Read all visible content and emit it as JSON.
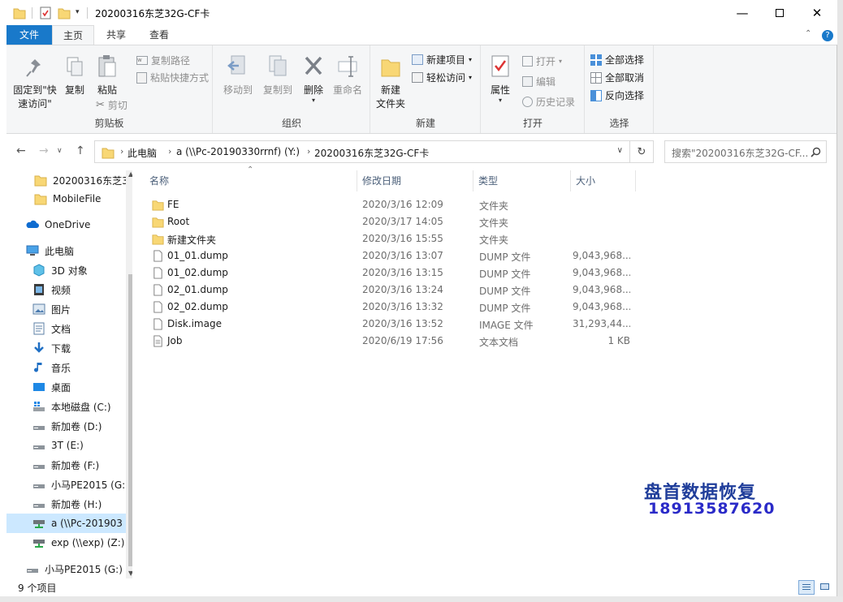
{
  "window": {
    "title": "20200316东芝32G-CF卡",
    "minimize_icon": "minimize-icon",
    "maximize_icon": "maximize-icon",
    "close_icon": "close-icon"
  },
  "ribbon_tabs": [
    "文件",
    "主页",
    "共享",
    "查看"
  ],
  "ribbon": {
    "clipboard": {
      "label": "剪贴板",
      "pin_label_1": "固定到\"快",
      "pin_label_2": "速访问\"",
      "copy": "复制",
      "paste": "粘贴",
      "copy_path": "复制路径",
      "paste_shortcut": "粘贴快捷方式",
      "cut": "剪切"
    },
    "organize": {
      "label": "组织",
      "move_to": "移动到",
      "copy_to": "复制到",
      "delete": "删除",
      "rename": "重命名"
    },
    "new": {
      "label": "新建",
      "new_folder_1": "新建",
      "new_folder_2": "文件夹",
      "new_item": "新建项目",
      "easy_access": "轻松访问"
    },
    "open": {
      "label": "打开",
      "properties": "属性",
      "open": "打开",
      "edit": "编辑",
      "history": "历史记录"
    },
    "select": {
      "label": "选择",
      "select_all": "全部选择",
      "select_none": "全部取消",
      "invert": "反向选择"
    }
  },
  "address": {
    "crumbs": [
      "此电脑",
      "a (\\\\Pc-20190330rrnf) (Y:)",
      "20200316东芝32G-CF卡"
    ],
    "search_placeholder": "搜索\"20200316东芝32G-CF..."
  },
  "nav_pane": {
    "items": [
      {
        "label": "20200316东芝3",
        "icon": "folder-icon"
      },
      {
        "label": "MobileFile",
        "icon": "folder-icon"
      },
      {
        "label": "OneDrive",
        "icon": "cloud-icon"
      },
      {
        "label": "此电脑",
        "icon": "computer-icon"
      },
      {
        "label": "3D 对象",
        "icon": "3d-objects-icon"
      },
      {
        "label": "视频",
        "icon": "video-icon"
      },
      {
        "label": "图片",
        "icon": "pictures-icon"
      },
      {
        "label": "文档",
        "icon": "documents-icon"
      },
      {
        "label": "下载",
        "icon": "download-icon"
      },
      {
        "label": "音乐",
        "icon": "music-icon"
      },
      {
        "label": "桌面",
        "icon": "desktop-icon"
      },
      {
        "label": "本地磁盘 (C:)",
        "icon": "system-drive-icon"
      },
      {
        "label": "新加卷 (D:)",
        "icon": "drive-icon"
      },
      {
        "label": "3T (E:)",
        "icon": "drive-icon"
      },
      {
        "label": "新加卷 (F:)",
        "icon": "drive-icon"
      },
      {
        "label": "小马PE2015 (G:",
        "icon": "drive-icon"
      },
      {
        "label": "新加卷 (H:)",
        "icon": "drive-icon"
      },
      {
        "label": "a (\\\\Pc-201903",
        "icon": "network-drive-icon"
      },
      {
        "label": "exp (\\\\exp) (Z:)",
        "icon": "network-drive-icon"
      },
      {
        "label": "小马PE2015 (G:)",
        "icon": "drive-icon"
      }
    ],
    "selected": "a (\\\\Pc-201903"
  },
  "columns": {
    "name": "名称",
    "date": "修改日期",
    "type": "类型",
    "size": "大小"
  },
  "files": [
    {
      "name": "FE",
      "date": "2020/3/16 12:09",
      "type": "文件夹",
      "size": "",
      "icon": "folder-icon"
    },
    {
      "name": "Root",
      "date": "2020/3/17 14:05",
      "type": "文件夹",
      "size": "",
      "icon": "folder-icon"
    },
    {
      "name": "新建文件夹",
      "date": "2020/3/16 15:55",
      "type": "文件夹",
      "size": "",
      "icon": "folder-icon"
    },
    {
      "name": "01_01.dump",
      "date": "2020/3/16 13:07",
      "type": "DUMP 文件",
      "size": "9,043,968...",
      "icon": "file-icon"
    },
    {
      "name": "01_02.dump",
      "date": "2020/3/16 13:15",
      "type": "DUMP 文件",
      "size": "9,043,968...",
      "icon": "file-icon"
    },
    {
      "name": "02_01.dump",
      "date": "2020/3/16 13:24",
      "type": "DUMP 文件",
      "size": "9,043,968...",
      "icon": "file-icon"
    },
    {
      "name": "02_02.dump",
      "date": "2020/3/16 13:32",
      "type": "DUMP 文件",
      "size": "9,043,968...",
      "icon": "file-icon"
    },
    {
      "name": "Disk.image",
      "date": "2020/3/16 13:52",
      "type": "IMAGE 文件",
      "size": "31,293,44...",
      "icon": "file-icon"
    },
    {
      "name": "Job",
      "date": "2020/6/19 17:56",
      "type": "文本文档",
      "size": "1 KB",
      "icon": "text-file-icon"
    }
  ],
  "watermark": {
    "line1": "盘首数据恢复",
    "line2": "18913587620"
  },
  "status": {
    "count": "9 个项目"
  },
  "colors": {
    "file_tab": "#1979ca",
    "selection": "#cce8ff",
    "folder": "#f8d775",
    "watermark_1": "#1f3d9a",
    "watermark_2": "#2a2ac8"
  }
}
